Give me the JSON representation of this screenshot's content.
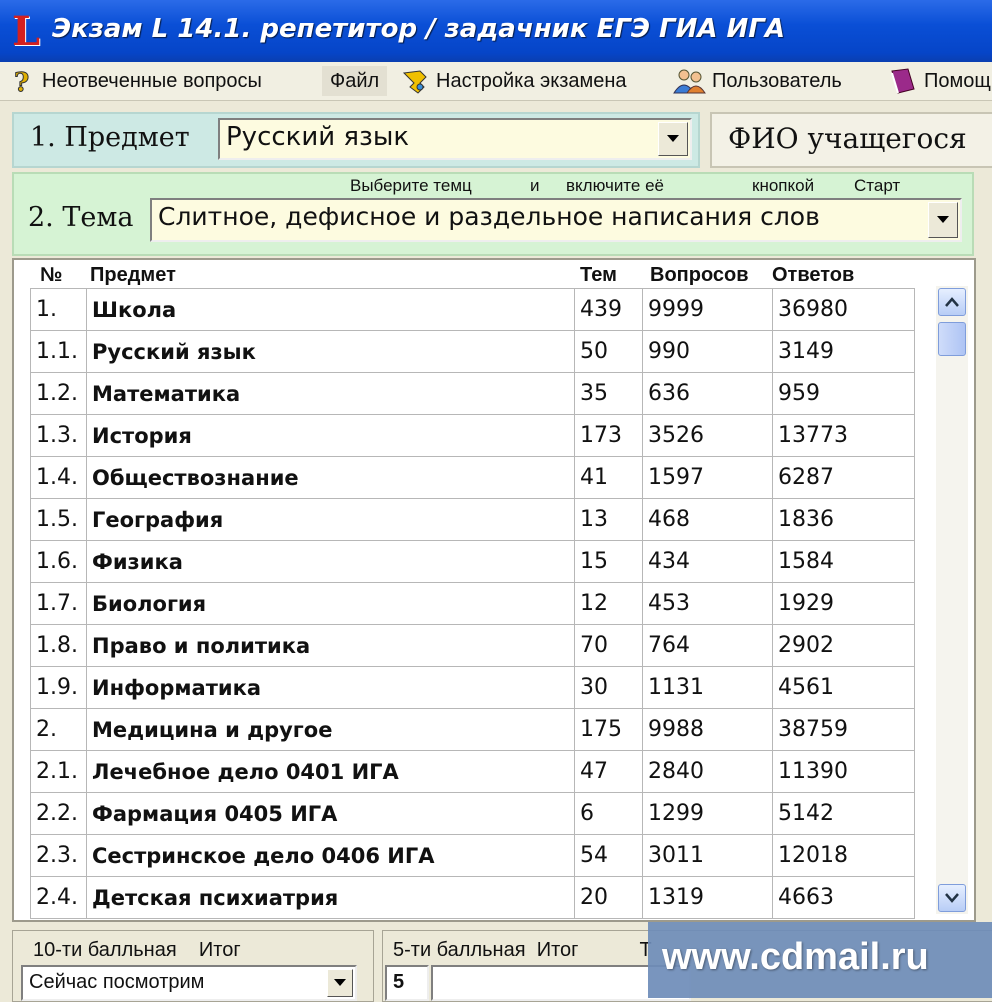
{
  "window": {
    "title": "Экзам L 14.1.  репетитор / задачник ЕГЭ ГИА ИГА",
    "logo_letter": "L"
  },
  "menu": [
    {
      "label": "Неотвеченные вопросы",
      "icon": "question-icon"
    },
    {
      "label": "Файл",
      "icon": ""
    },
    {
      "label": "Настройка экзамена",
      "icon": "tools-icon"
    },
    {
      "label": "Пользователь",
      "icon": "users-icon"
    },
    {
      "label": "Помощь",
      "icon": "book-icon"
    }
  ],
  "subject": {
    "label": "1. Предмет",
    "value": "Русский язык"
  },
  "student": {
    "label": "ФИО учащегося"
  },
  "topic": {
    "hint_1": "Выберите темц",
    "hint_2": "и",
    "hint_3": "включите её",
    "hint_4": "кнопкой",
    "hint_5": "Старт",
    "label": "2. Тема",
    "value": "Слитное, дефисное и раздельное написания слов"
  },
  "table": {
    "headers": {
      "no": "№",
      "subject": "Предмет",
      "topics": "Тем",
      "questions": "Вопросов",
      "answers": "Ответов"
    },
    "rows": [
      [
        "1.",
        "Школа",
        "439",
        "9999",
        "36980"
      ],
      [
        "1.1.",
        "Русский язык",
        "50",
        "990",
        "3149"
      ],
      [
        "1.2.",
        "Математика",
        "35",
        "636",
        "959"
      ],
      [
        "1.3.",
        "История",
        "173",
        "3526",
        "13773"
      ],
      [
        "1.4.",
        "Обществознание",
        "41",
        "1597",
        "6287"
      ],
      [
        "1.5.",
        "География",
        "13",
        "468",
        "1836"
      ],
      [
        "1.6.",
        "Физика",
        "15",
        "434",
        "1584"
      ],
      [
        "1.7.",
        "Биология",
        "12",
        "453",
        "1929"
      ],
      [
        "1.8.",
        "Право и политика",
        "70",
        "764",
        "2902"
      ],
      [
        "1.9.",
        "Информатика",
        "30",
        "1131",
        "4561"
      ],
      [
        "2.",
        "Медицина и другое",
        "175",
        "9988",
        "38759"
      ],
      [
        "2.1.",
        "Лечебное дело 0401 ИГА",
        "47",
        "2840",
        "11390"
      ],
      [
        "2.2.",
        "Фармация 0405 ИГА",
        "6",
        "1299",
        "5142"
      ],
      [
        "2.3.",
        "Сестринское дело 0406 ИГА",
        "54",
        "3011",
        "12018"
      ],
      [
        "2.4.",
        "Детская психиатрия",
        "20",
        "1319",
        "4663"
      ]
    ]
  },
  "bottom": {
    "ten_point": "10-ти балльная",
    "ten_total": "Итог",
    "ten_value": "Сейчас посмотрим",
    "five_point": "5-ти балльная",
    "five_total": "Итог",
    "five_extra": "Т",
    "five_value": "5"
  },
  "watermark": "www.cdmail.ru"
}
